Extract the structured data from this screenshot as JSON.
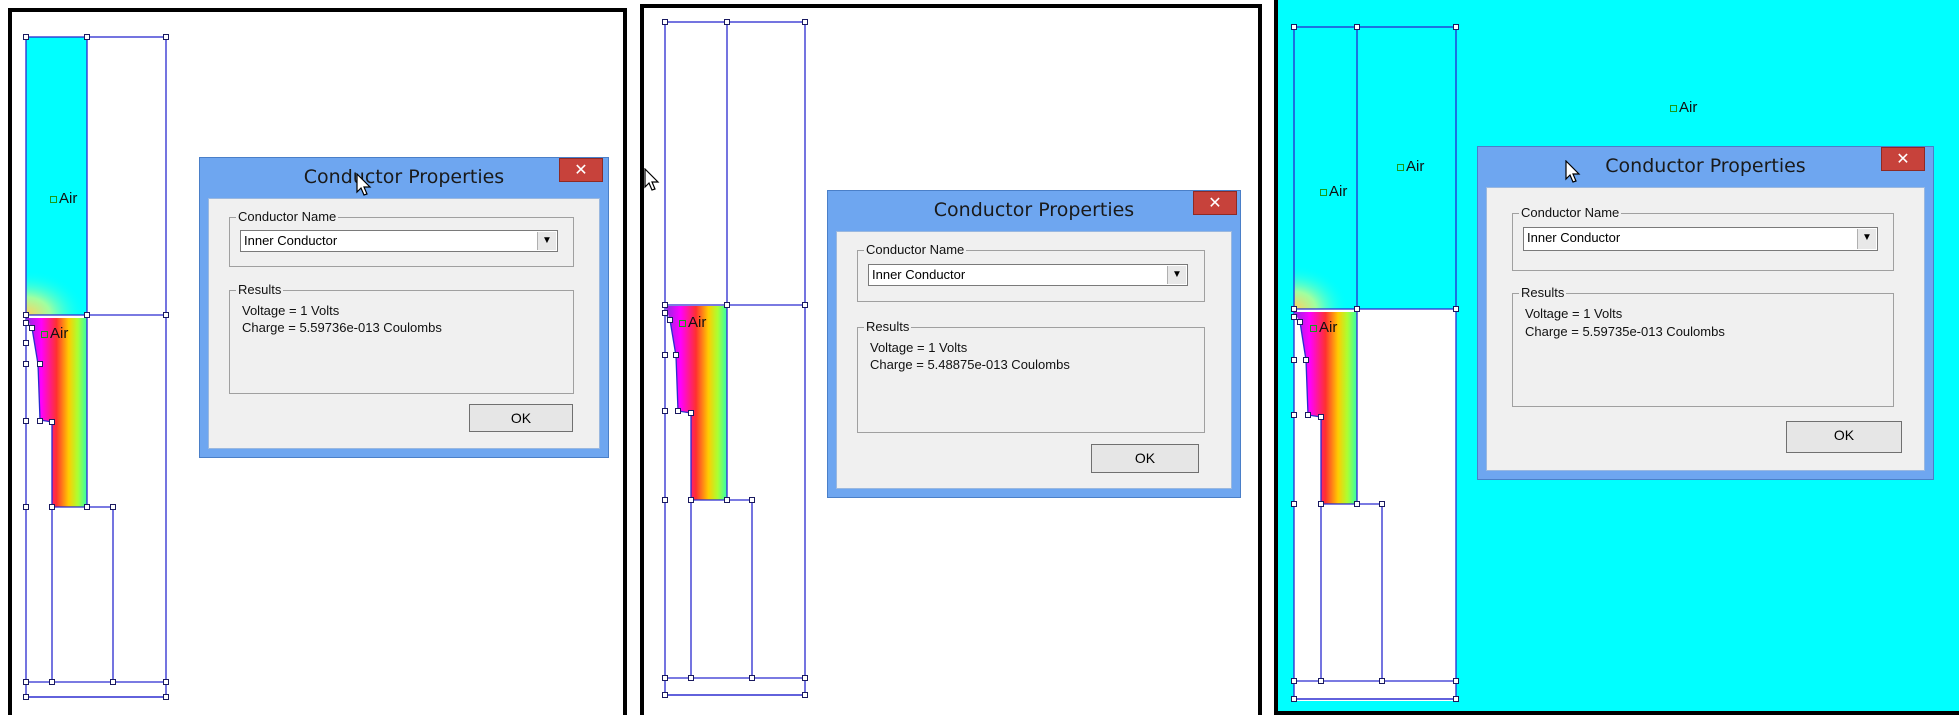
{
  "panels": [
    {
      "background": "#ffffff",
      "dialog": {
        "title": "Conductor Properties",
        "close_label": "✕",
        "conductor_group_label": "Conductor Name",
        "conductor_value": "Inner Conductor",
        "results_group_label": "Results",
        "voltage_text": "Voltage = 1 Volts",
        "charge_text": "Charge = 5.59736e-013 Coulombs",
        "ok_label": "OK"
      },
      "air_labels": [
        "Air",
        "Air"
      ]
    },
    {
      "background": "#ffffff",
      "dialog": {
        "title": "Conductor Properties",
        "close_label": "✕",
        "conductor_group_label": "Conductor Name",
        "conductor_value": "Inner Conductor",
        "results_group_label": "Results",
        "voltage_text": "Voltage = 1 Volts",
        "charge_text": "Charge = 5.48875e-013 Coulombs",
        "ok_label": "OK"
      },
      "air_labels": [
        "Air"
      ]
    },
    {
      "background": "#00ffff",
      "dialog": {
        "title": "Conductor Properties",
        "close_label": "✕",
        "conductor_group_label": "Conductor Name",
        "conductor_value": "Inner Conductor",
        "results_group_label": "Results",
        "voltage_text": "Voltage = 1 Volts",
        "charge_text": "Charge = 5.59735e-013 Coulombs",
        "ok_label": "OK"
      },
      "air_labels": [
        "Air",
        "Air",
        "Air",
        "Air"
      ]
    }
  ],
  "colors": {
    "field_cyan": "#00ffff",
    "geometry_line": "#2a2ad0",
    "node_marker": "#1a1a60",
    "dialog_frame": "#6ea6f0",
    "close_button": "#c7423b"
  },
  "icons": [
    "close-icon",
    "dropdown-arrow-icon",
    "mouse-cursor-icon"
  ]
}
